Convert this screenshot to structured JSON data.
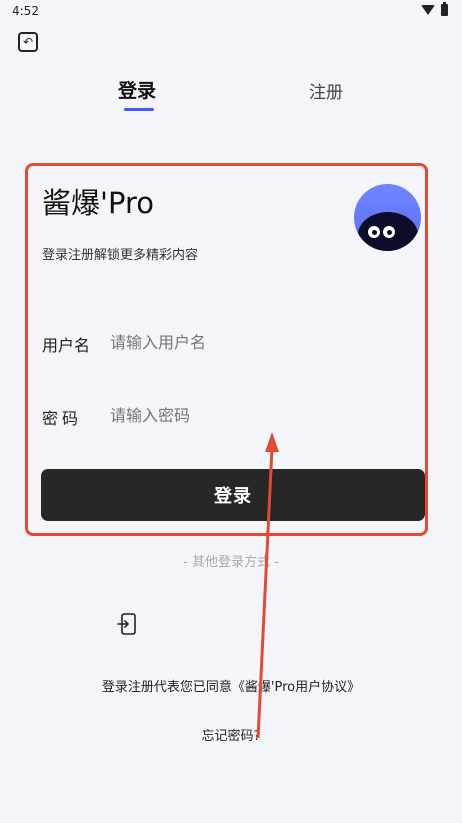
{
  "status": {
    "time": "4:52"
  },
  "tabs": {
    "login": "登录",
    "register": "注册"
  },
  "card": {
    "title": "酱爆'Pro",
    "subtitle": "登录注册解锁更多精彩内容",
    "username_label": "用户名",
    "username_placeholder": "请输入用户名",
    "password_label": "密码",
    "password_placeholder": "请输入密码",
    "login_button": "登录"
  },
  "other_login_label": "- 其他登录方式 -",
  "agreement_text": "登录注册代表您已同意《酱爆'Pro用户协议》",
  "forgot_password": "忘记密码?",
  "colors": {
    "accent": "#4457ff",
    "button": "#272727",
    "highlight": "#e34a35"
  },
  "icons": [
    "back-icon",
    "wifi-icon",
    "battery-icon",
    "phone-login-icon"
  ]
}
